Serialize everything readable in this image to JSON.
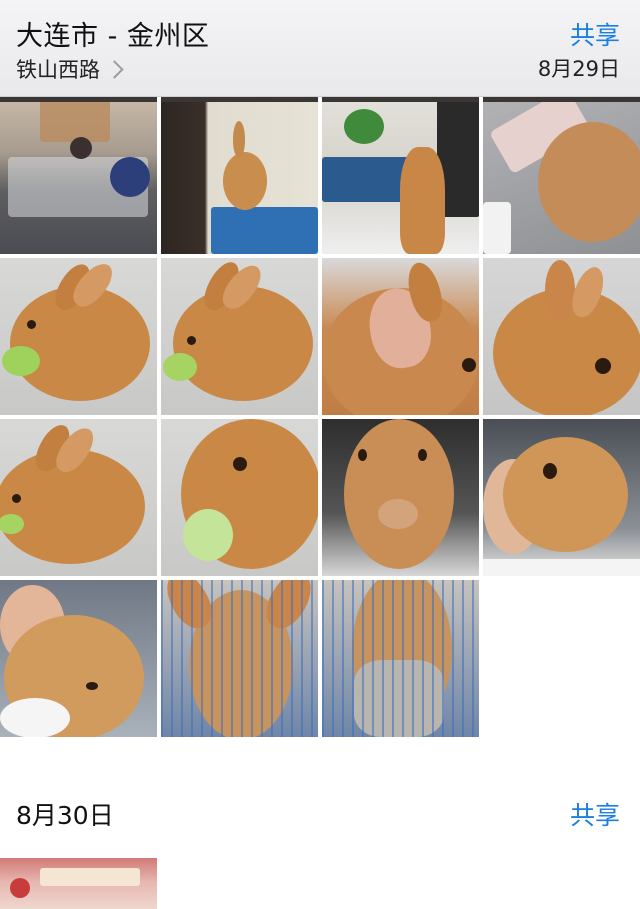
{
  "header": {
    "title": "大连市 - 金州区",
    "subtitle": "铁山西路",
    "share_label": "共享",
    "date": "8月29日"
  },
  "section2": {
    "date": "8月30日",
    "share_label": "共享"
  }
}
